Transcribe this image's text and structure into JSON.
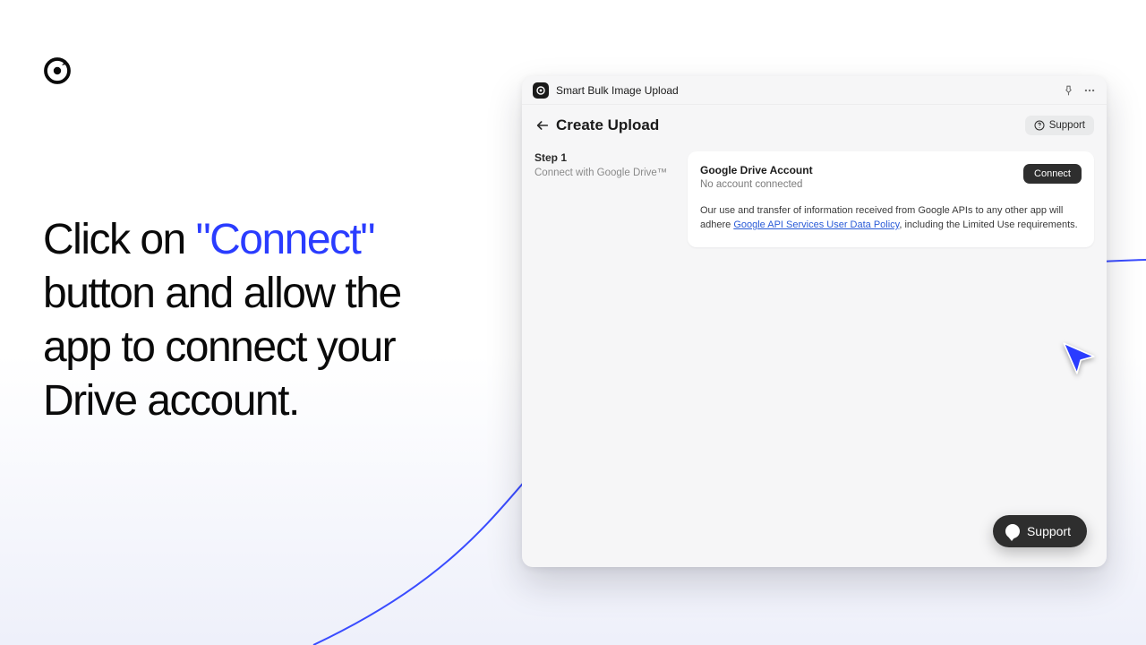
{
  "headline": {
    "pre": "Click on ",
    "accent": "\"Connect\"",
    "post": " button and allow the app to connect your Drive account."
  },
  "window": {
    "title": "Smart Bulk Image Upload",
    "header": {
      "title": "Create Upload",
      "support_label": "Support"
    },
    "step": {
      "label": "Step 1",
      "desc": "Connect with Google Drive™"
    },
    "card": {
      "title": "Google Drive Account",
      "sub": "No account connected",
      "connect_label": "Connect",
      "legal_pre": "Our use and transfer of information received from Google APIs to any other app will adhere ",
      "legal_link": "Google API Services User Data Policy",
      "legal_post": ", including the Limited Use requirements."
    },
    "support_pill": "Support"
  }
}
